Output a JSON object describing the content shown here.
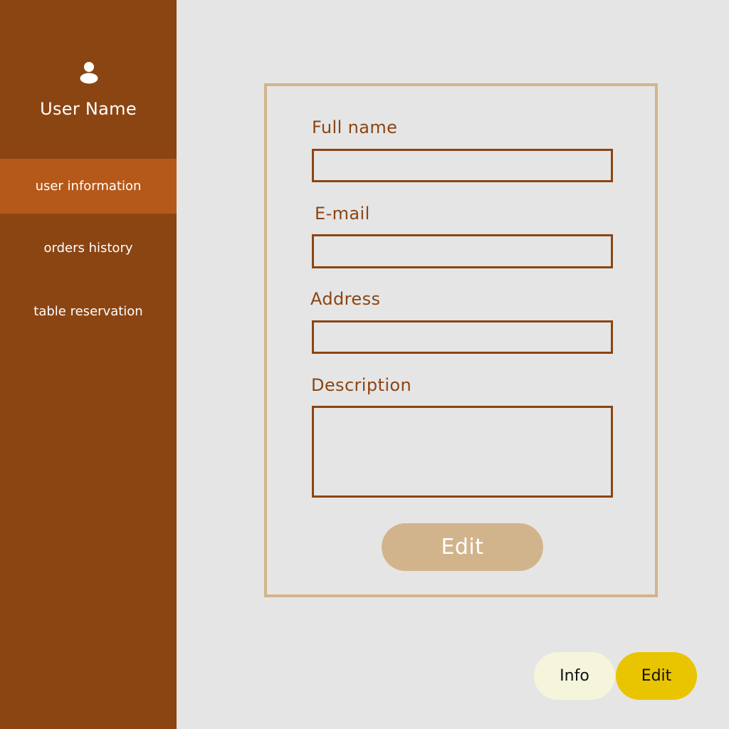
{
  "sidebar": {
    "user_name": "User Name",
    "avatar_icon": "user-icon",
    "items": [
      {
        "label": "user information",
        "active": true
      },
      {
        "label": "orders history",
        "active": false
      },
      {
        "label": "table reservation",
        "active": false
      }
    ]
  },
  "form": {
    "full_name": {
      "label": "Full name",
      "value": ""
    },
    "email": {
      "label": "E-mail",
      "value": ""
    },
    "address": {
      "label": "Address",
      "value": ""
    },
    "description": {
      "label": "Description",
      "value": ""
    },
    "edit_label": "Edit"
  },
  "footer": {
    "info_label": "Info",
    "edit_label": "Edit"
  },
  "colors": {
    "sidebar": "#8b4513",
    "sidebar_active": "#b5591a",
    "card_border": "#d2b48c",
    "field_border": "#8b4513",
    "edit_button": "#d2b48c",
    "info_pill": "#f5f5dc",
    "edit_pill": "#e9c400"
  }
}
